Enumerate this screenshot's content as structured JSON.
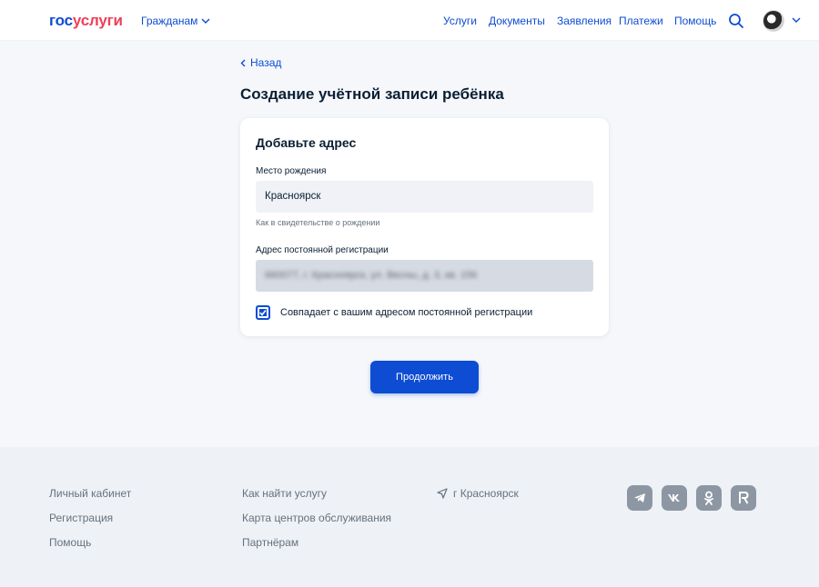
{
  "header": {
    "logo_part1": "гос",
    "logo_part2": "услуги",
    "audience": "Гражданам",
    "nav": [
      "Услуги",
      "Документы",
      "Заявления",
      "Платежи",
      "Помощь"
    ]
  },
  "main": {
    "back": "Назад",
    "title": "Создание учётной записи ребёнка",
    "card": {
      "title": "Добавьте адрес",
      "birthplace_label": "Место рождения",
      "birthplace_value": "Красноярск",
      "birthplace_hint": "Как в свидетельстве о рождении",
      "registration_label": "Адрес постоянной регистрации",
      "registration_value": "660077, г. Красноярск, ул. Весны, д. 3, кв. 156",
      "checkbox_checked": true,
      "checkbox_label": "Совпадает с вашим адресом постоянной регистрации"
    },
    "continue": "Продолжить"
  },
  "footer": {
    "col1": [
      "Личный кабинет",
      "Регистрация",
      "Помощь"
    ],
    "col2": [
      "Как найти услугу",
      "Карта центров обслуживания",
      "Партнёрам"
    ],
    "location": "г Красноярск",
    "social": [
      "telegram-icon",
      "vk-icon",
      "ok-icon",
      "rutube-icon"
    ]
  },
  "colors": {
    "primary": "#0d4cd3",
    "brand_red": "#ee3f58",
    "background": "#f5f7fb",
    "footer": "#eef1f5"
  }
}
